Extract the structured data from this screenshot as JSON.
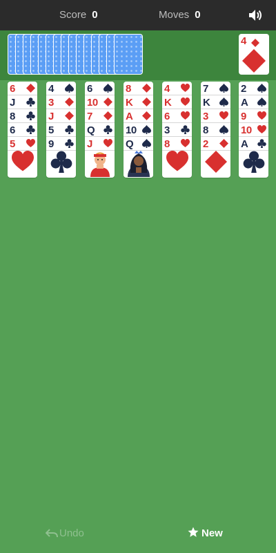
{
  "header": {
    "score_label": "Score",
    "score_value": "0",
    "moves_label": "Moves",
    "moves_value": "0",
    "sound_icon": "speaker-icon"
  },
  "stock": {
    "card_count": 15
  },
  "foundation": {
    "rank": "4",
    "suit": "diamond"
  },
  "columns": [
    {
      "cards": [
        {
          "rank": "6",
          "suit": "diamond"
        },
        {
          "rank": "J",
          "suit": "club"
        },
        {
          "rank": "8",
          "suit": "club"
        },
        {
          "rank": "6",
          "suit": "club"
        },
        {
          "rank": "5",
          "suit": "heart"
        }
      ]
    },
    {
      "cards": [
        {
          "rank": "4",
          "suit": "spade"
        },
        {
          "rank": "3",
          "suit": "diamond"
        },
        {
          "rank": "J",
          "suit": "diamond"
        },
        {
          "rank": "5",
          "suit": "club"
        },
        {
          "rank": "9",
          "suit": "club"
        }
      ]
    },
    {
      "cards": [
        {
          "rank": "6",
          "suit": "spade"
        },
        {
          "rank": "10",
          "suit": "diamond"
        },
        {
          "rank": "7",
          "suit": "diamond"
        },
        {
          "rank": "Q",
          "suit": "club"
        },
        {
          "rank": "J",
          "suit": "heart"
        }
      ]
    },
    {
      "cards": [
        {
          "rank": "8",
          "suit": "diamond"
        },
        {
          "rank": "K",
          "suit": "diamond"
        },
        {
          "rank": "A",
          "suit": "diamond"
        },
        {
          "rank": "10",
          "suit": "spade"
        },
        {
          "rank": "Q",
          "suit": "spade"
        }
      ]
    },
    {
      "cards": [
        {
          "rank": "4",
          "suit": "heart"
        },
        {
          "rank": "K",
          "suit": "heart"
        },
        {
          "rank": "6",
          "suit": "heart"
        },
        {
          "rank": "3",
          "suit": "club"
        },
        {
          "rank": "8",
          "suit": "heart"
        }
      ]
    },
    {
      "cards": [
        {
          "rank": "7",
          "suit": "spade"
        },
        {
          "rank": "K",
          "suit": "spade"
        },
        {
          "rank": "3",
          "suit": "heart"
        },
        {
          "rank": "8",
          "suit": "spade"
        },
        {
          "rank": "2",
          "suit": "diamond"
        }
      ]
    },
    {
      "cards": [
        {
          "rank": "2",
          "suit": "spade"
        },
        {
          "rank": "A",
          "suit": "spade"
        },
        {
          "rank": "9",
          "suit": "heart"
        },
        {
          "rank": "10",
          "suit": "heart"
        },
        {
          "rank": "A",
          "suit": "club"
        }
      ]
    }
  ],
  "footer": {
    "undo_label": "Undo",
    "new_label": "New"
  },
  "colors": {
    "table_green": "#55a055",
    "stock_bar": "#3d853d",
    "top_bar": "#2b2b2b",
    "card_back": "#5b9ef5",
    "red_suit": "#d8302f",
    "black_suit": "#1e2a4a"
  }
}
